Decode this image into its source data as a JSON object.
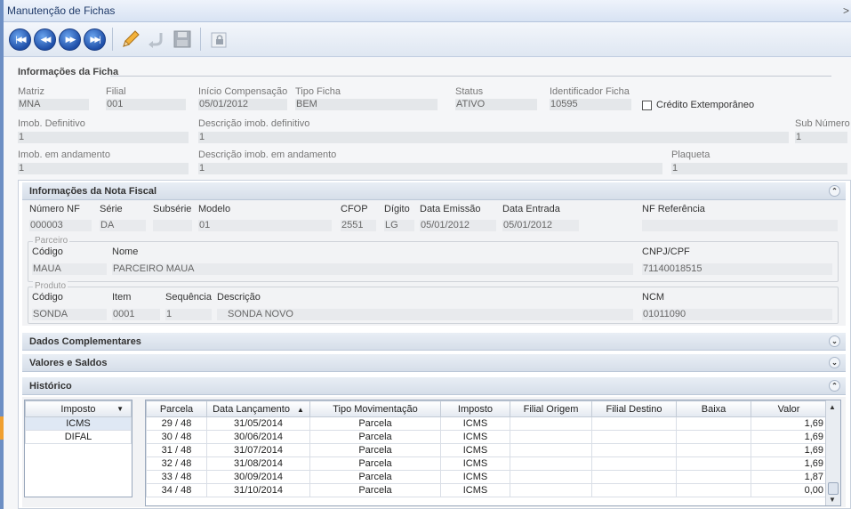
{
  "window": {
    "title": "Manutenção de Fichas",
    "close_glyph": ">"
  },
  "ficha": {
    "section_title": "Informações da Ficha",
    "matriz": {
      "label": "Matriz",
      "value": "MNA"
    },
    "filial": {
      "label": "Filial",
      "value": "001"
    },
    "inicio_compensacao": {
      "label": "Início Compensação",
      "value": "05/01/2012"
    },
    "tipo_ficha": {
      "label": "Tipo Ficha",
      "value": "BEM"
    },
    "status": {
      "label": "Status",
      "value": "ATIVO"
    },
    "identificador": {
      "label": "Identificador Ficha",
      "value": "10595"
    },
    "credito_extemporaneo": {
      "label": "Crédito Extemporâneo",
      "checked": false
    },
    "imob_definitivo": {
      "label": "Imob. Definitivo",
      "value": "1"
    },
    "desc_imob_definitivo": {
      "label": "Descrição imob. definitivo",
      "value": "1"
    },
    "sub_numero": {
      "label": "Sub Número",
      "value": "1"
    },
    "imob_andamento": {
      "label": "Imob. em andamento",
      "value": "1"
    },
    "desc_imob_andamento": {
      "label": "Descrição imob. em andamento",
      "value": "1"
    },
    "plaqueta": {
      "label": "Plaqueta",
      "value": "1"
    }
  },
  "nota_fiscal": {
    "title": "Informações da Nota Fiscal",
    "labels": {
      "numero": "Número NF",
      "serie": "Série",
      "subserie": "Subsérie",
      "modelo": "Modelo",
      "cfop": "CFOP",
      "digito": "Dígito",
      "data_emissao": "Data Emissão",
      "data_entrada": "Data Entrada",
      "nf_referencia": "NF Referência"
    },
    "values": {
      "numero": "000003",
      "serie": "DA",
      "subserie": "",
      "modelo": "01",
      "cfop": "2551",
      "digito": "LG",
      "data_emissao": "05/01/2012",
      "data_entrada": "05/01/2012",
      "nf_referencia": ""
    },
    "parceiro": {
      "group": "Parceiro",
      "labels": {
        "codigo": "Código",
        "nome": "Nome",
        "cnpj": "CNPJ/CPF"
      },
      "values": {
        "codigo": "MAUA",
        "nome": "PARCEIRO MAUA",
        "cnpj": "71140018515"
      }
    },
    "produto": {
      "group": "Produto",
      "labels": {
        "codigo": "Código",
        "item": "Item",
        "sequencia": "Sequência",
        "descricao": "Descrição",
        "ncm": "NCM"
      },
      "values": {
        "codigo": "SONDA",
        "item": "0001",
        "sequencia": "1",
        "descricao": "SONDA NOVO",
        "ncm": "01011090"
      }
    }
  },
  "panels": {
    "dados_complementares": "Dados Complementares",
    "valores_saldos": "Valores e Saldos",
    "historico": "Histórico"
  },
  "historico": {
    "imposto_header": "Imposto",
    "impostos": [
      "ICMS",
      "DIFAL"
    ],
    "columns": [
      "Parcela",
      "Data Lançamento",
      "Tipo Movimentação",
      "Imposto",
      "Filial Origem",
      "Filial Destino",
      "Baixa",
      "Valor"
    ],
    "sort_indicator": "▲",
    "rows": [
      [
        "29 / 48",
        "31/05/2014",
        "Parcela",
        "ICMS",
        "",
        "",
        "",
        "1,69"
      ],
      [
        "30 / 48",
        "30/06/2014",
        "Parcela",
        "ICMS",
        "",
        "",
        "",
        "1,69"
      ],
      [
        "31 / 48",
        "31/07/2014",
        "Parcela",
        "ICMS",
        "",
        "",
        "",
        "1,69"
      ],
      [
        "32 / 48",
        "31/08/2014",
        "Parcela",
        "ICMS",
        "",
        "",
        "",
        "1,69"
      ],
      [
        "33 / 48",
        "30/09/2014",
        "Parcela",
        "ICMS",
        "",
        "",
        "",
        "1,87"
      ],
      [
        "34 / 48",
        "31/10/2014",
        "Parcela",
        "ICMS",
        "",
        "",
        "",
        "0,00"
      ]
    ]
  },
  "icons": {
    "first": "first-record-icon",
    "prev": "previous-record-icon",
    "next": "next-record-icon",
    "last": "last-record-icon",
    "edit": "pencil-icon",
    "undo": "undo-icon",
    "save": "save-icon",
    "lock": "lock-icon",
    "collapse": "chevron-up-icon",
    "expand": "chevron-down-icon"
  },
  "colors": {
    "title_text": "#1e3968",
    "nav_blue": "#1f4fa8",
    "accent_strip": "#6d8fc4"
  }
}
